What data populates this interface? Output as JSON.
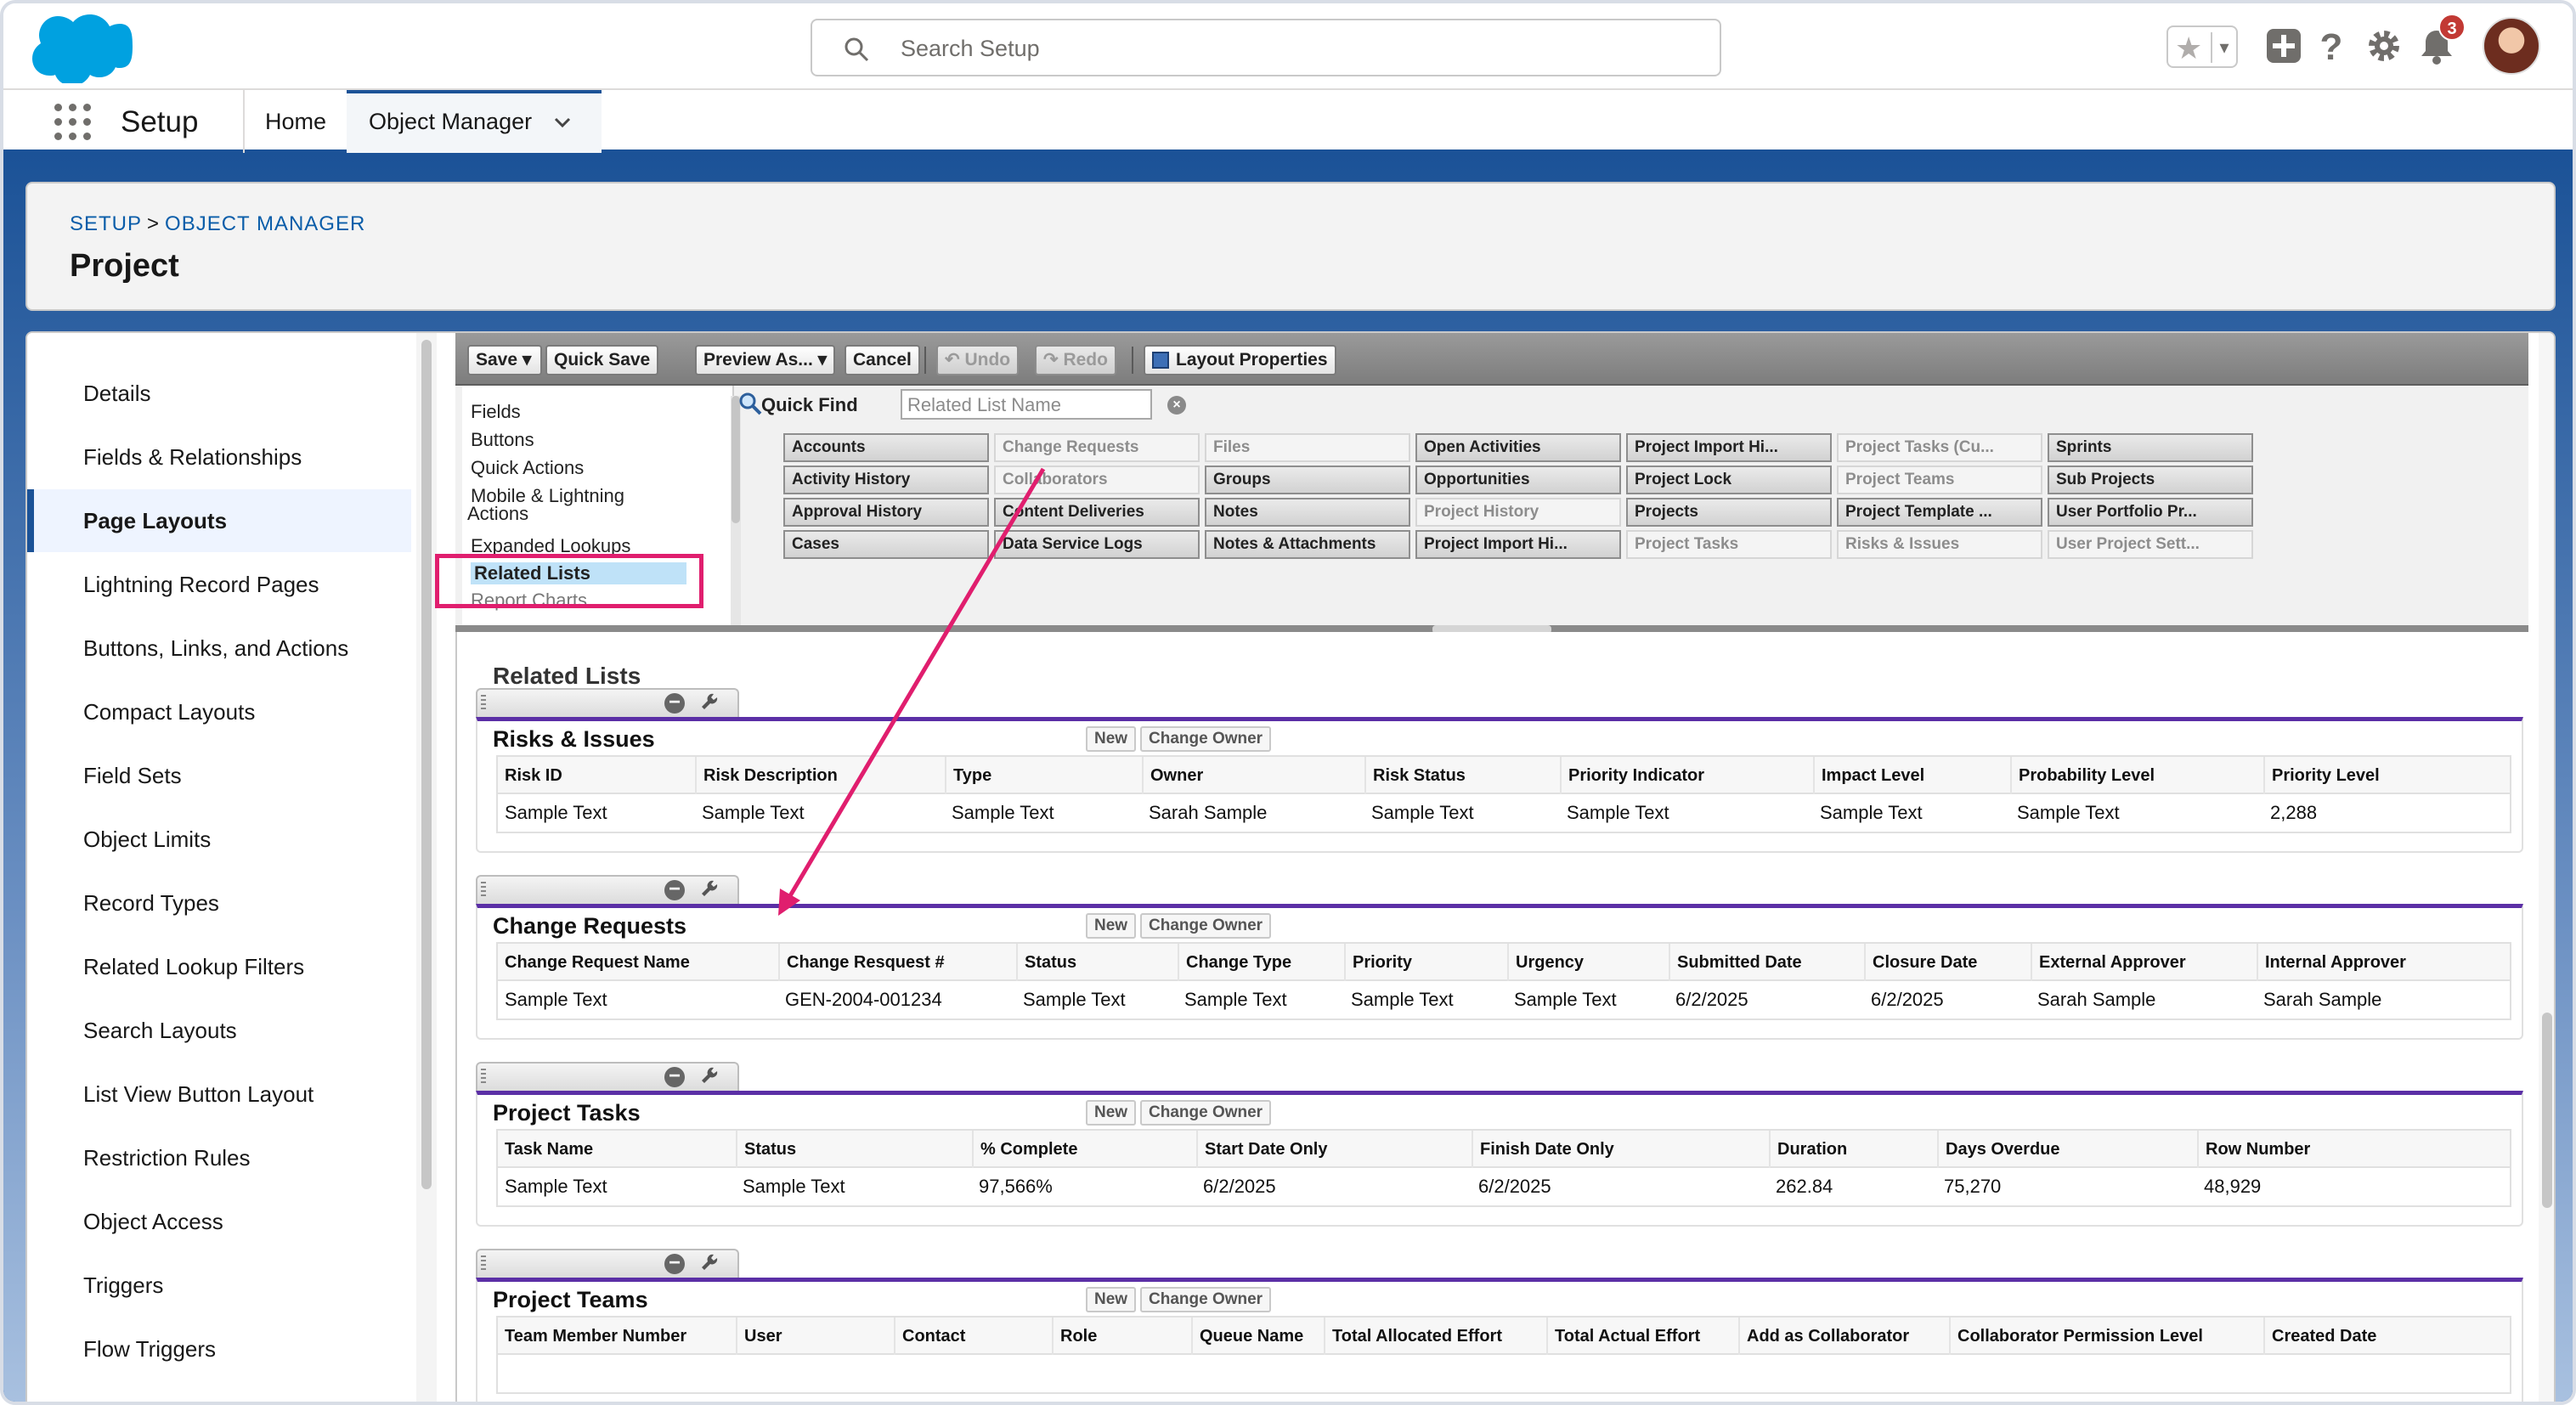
{
  "header": {
    "search_placeholder": "Search Setup",
    "notification_count": "3"
  },
  "nav": {
    "app_name": "Setup",
    "home": "Home",
    "object_manager": "Object Manager"
  },
  "page": {
    "breadcrumb_setup": "SETUP",
    "breadcrumb_sep": ">",
    "breadcrumb_om": "OBJECT MANAGER",
    "title": "Project"
  },
  "sidebar": {
    "items": [
      {
        "label": "Details"
      },
      {
        "label": "Fields & Relationships"
      },
      {
        "label": "Page Layouts"
      },
      {
        "label": "Lightning Record Pages"
      },
      {
        "label": "Buttons, Links, and Actions"
      },
      {
        "label": "Compact Layouts"
      },
      {
        "label": "Field Sets"
      },
      {
        "label": "Object Limits"
      },
      {
        "label": "Record Types"
      },
      {
        "label": "Related Lookup Filters"
      },
      {
        "label": "Search Layouts"
      },
      {
        "label": "List View Button Layout"
      },
      {
        "label": "Restriction Rules"
      },
      {
        "label": "Object Access"
      },
      {
        "label": "Triggers"
      },
      {
        "label": "Flow Triggers"
      }
    ],
    "active_index": 2
  },
  "toolbar": {
    "save": "Save",
    "quick_save": "Quick Save",
    "preview_as": "Preview As...",
    "cancel": "Cancel",
    "undo": "Undo",
    "redo": "Redo",
    "layout_properties": "Layout Properties"
  },
  "palette": {
    "categories": [
      "Fields",
      "Buttons",
      "Quick Actions",
      "Mobile & Lightning",
      "Actions",
      "Expanded Lookups",
      "Related Lists",
      "Report Charts"
    ],
    "quick_find_label": "Quick Find",
    "quick_find_placeholder": "Related List Name",
    "chips": [
      [
        "Accounts",
        "Activity History",
        "Approval History",
        "Cases"
      ],
      [
        "Change Requests",
        "Collaborators",
        "Content Deliveries",
        "Data Service Logs"
      ],
      [
        "Files",
        "Groups",
        "Notes",
        "Notes & Attachments"
      ],
      [
        "Open Activities",
        "Opportunities",
        "Project History",
        "Project Import Hi..."
      ],
      [
        "Project Import Hi...",
        "Project Lock",
        "Projects",
        "Project Tasks"
      ],
      [
        "Project Tasks (Cu...",
        "Project Teams",
        "Project Template ...",
        "Risks & Issues"
      ],
      [
        "Sprints",
        "Sub Projects",
        "User Portfolio Pr...",
        "User Project Sett..."
      ]
    ],
    "used": [
      [
        false,
        false,
        false,
        false
      ],
      [
        true,
        true,
        false,
        false
      ],
      [
        true,
        false,
        false,
        false
      ],
      [
        false,
        false,
        true,
        false
      ],
      [
        false,
        false,
        false,
        true
      ],
      [
        true,
        true,
        false,
        true
      ],
      [
        false,
        false,
        false,
        true
      ]
    ]
  },
  "related_lists": {
    "section_title": "Related Lists",
    "new_label": "New",
    "change_owner_label": "Change Owner",
    "lists": [
      {
        "name": "Risks & Issues",
        "columns": [
          "Risk ID",
          "Risk Description",
          "Type",
          "Owner",
          "Risk Status",
          "Priority Indicator",
          "Impact Level",
          "Probability Level",
          "Priority Level"
        ],
        "values": [
          "Sample Text",
          "Sample Text",
          "Sample Text",
          "Sarah Sample",
          "Sample Text",
          "Sample Text",
          "Sample Text",
          "Sample Text",
          "2,288"
        ]
      },
      {
        "name": "Change Requests",
        "columns": [
          "Change Request Name",
          "Change Resquest #",
          "Status",
          "Change Type",
          "Priority",
          "Urgency",
          "Submitted Date",
          "Closure Date",
          "External Approver",
          "Internal Approver"
        ],
        "values": [
          "Sample Text",
          "GEN-2004-001234",
          "Sample Text",
          "Sample Text",
          "Sample Text",
          "Sample Text",
          "6/2/2025",
          "6/2/2025",
          "Sarah Sample",
          "Sarah Sample"
        ]
      },
      {
        "name": "Project Tasks",
        "columns": [
          "Task Name",
          "Status",
          "% Complete",
          "Start Date Only",
          "Finish Date Only",
          "Duration",
          "Days Overdue",
          "Row Number"
        ],
        "values": [
          "Sample Text",
          "Sample Text",
          "97,566%",
          "6/2/2025",
          "6/2/2025",
          "262.84",
          "75,270",
          "48,929"
        ]
      },
      {
        "name": "Project Teams",
        "columns": [
          "Team Member Number",
          "User",
          "Contact",
          "Role",
          "Queue Name",
          "Total Allocated Effort",
          "Total Actual Effort",
          "Add as Collaborator",
          "Collaborator Permission Level",
          "Created Date"
        ],
        "values": []
      }
    ]
  },
  "colors": {
    "brand_blue": "#1b5297",
    "accent_purple": "#5b2fa6",
    "highlight_pink": "#e01e6e",
    "salesforce_cloud": "#00a1e0"
  }
}
